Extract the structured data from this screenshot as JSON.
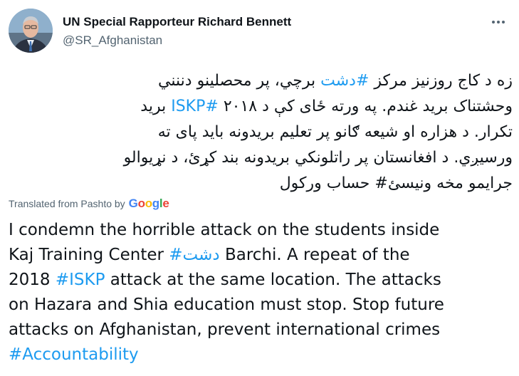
{
  "author": {
    "name": "UN Special Rapporteur Richard Bennett",
    "handle": "@SR_Afghanistan"
  },
  "menu": {
    "icon": "more-horizontal-icon"
  },
  "original_text": {
    "line1": {
      "before": "زه د کاج روزنیز مرکز ",
      "tag": "#دشت",
      "after": " برچي، پر محصلینو دننني"
    },
    "line2": {
      "before": "وحشتناک برید غندم. په ورته ځای کې د ۲۰۱۸ ",
      "tag": "#ISKP",
      "after": " برید"
    },
    "line3": "تکرار. د هزاره او شیعه ګانو پر تعلیم بریدونه باید پای ته",
    "line4": "ورسیږي. د افغانستان پر راتلونکي بریدونه بند کړئ، د نړیوالو",
    "line5": "جرایمو مخه ونیسئ# حساب ورکول"
  },
  "translation": {
    "label": "Translated from Pashto by",
    "provider": "Google",
    "provider_letters": [
      "G",
      "o",
      "o",
      "g",
      "l",
      "e"
    ],
    "provider_colors": [
      "#4285f4",
      "#ea4335",
      "#fbbc05",
      "#4285f4",
      "#34a853",
      "#ea4335"
    ]
  },
  "translated_text": {
    "line1": "I condemn the horrible attack on the students inside",
    "line2": {
      "before": "Kaj Training Center ",
      "tag": "دشت#",
      "after": " Barchi. A repeat of the"
    },
    "line3": {
      "before": "2018 ",
      "tag": "#ISKP",
      "after": " attack at the same location. The attacks"
    },
    "line4": "on Hazara and Shia education must stop. Stop future",
    "line5": "attacks on Afghanistan, prevent international crimes",
    "line6": "#Accountability"
  },
  "colors": {
    "link": "#1d9bf0",
    "text": "#0f1419",
    "secondary": "#536471"
  }
}
